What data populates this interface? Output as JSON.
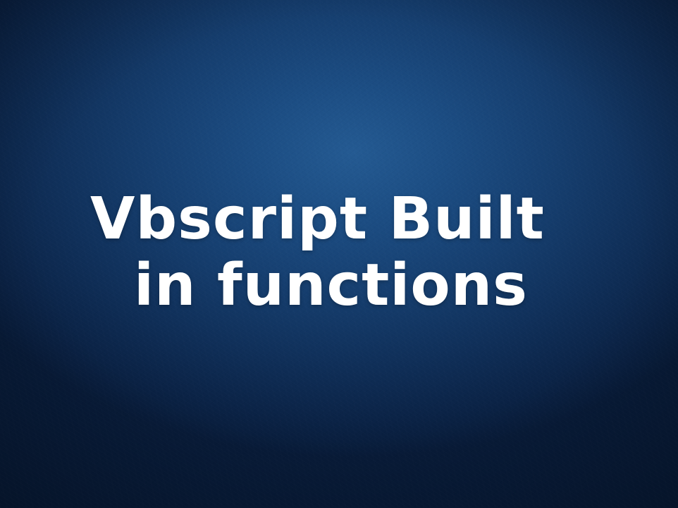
{
  "title": {
    "line1": "Vbscript Built",
    "line2": "in functions"
  },
  "colors": {
    "text": "#ffffff",
    "background_center": "#245a92",
    "background_edge": "#081b38"
  }
}
